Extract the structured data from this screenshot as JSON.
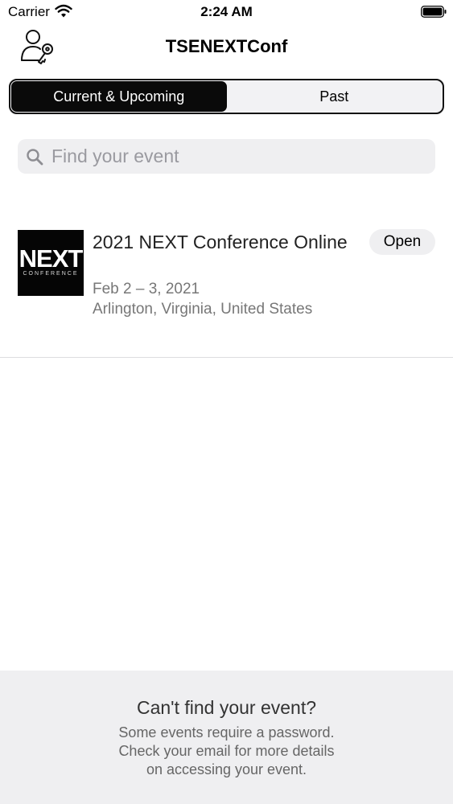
{
  "status_bar": {
    "carrier": "Carrier",
    "time": "2:24 AM"
  },
  "nav": {
    "title": "TSENEXTConf",
    "login_icon": "user-key-icon"
  },
  "segments": [
    {
      "label": "Current & Upcoming",
      "selected": true
    },
    {
      "label": "Past",
      "selected": false
    }
  ],
  "search": {
    "placeholder": "Find your event",
    "value": ""
  },
  "events": [
    {
      "logo_text": "NEXT",
      "logo_subtext": "CONFERENCE",
      "title": "2021 NEXT Conference Online",
      "dates": "Feb 2 – 3, 2021",
      "location": "Arlington, Virginia, United States",
      "action_label": "Open"
    }
  ],
  "footer": {
    "title": "Can't find your event?",
    "lines": [
      "Some events require a password.",
      "Check your email for more details",
      "on accessing your event."
    ]
  },
  "colors": {
    "segment_active_bg": "#0a0a0a",
    "surface": "#efeff1",
    "secondary_text": "#777777"
  }
}
